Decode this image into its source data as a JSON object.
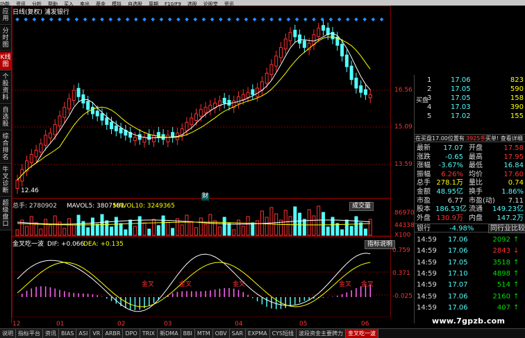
{
  "menu": [
    "功能",
    "资讯",
    "分析",
    "帮助",
    "买入",
    "卖出",
    "基金",
    "模拟",
    "自选股",
    "周期",
    "F10/F9",
    "选股",
    "论股堂",
    "资讯"
  ],
  "sidebar": [
    "应用",
    "分时图",
    "K线图",
    "个股资料",
    "自选股",
    "综合排名",
    "牛叉诊断",
    "超级盘口"
  ],
  "chart": {
    "title": "日线(复权) 浦发银行",
    "price_ticks": [
      "16.56",
      "15.09",
      "13.59"
    ],
    "low_label": "12.46",
    "cai_label": "财",
    "volume_label": "总手: 2780902",
    "mavol5": "MAVOL5: 3807581",
    "mavol10": "MAVOL10: 3249365",
    "vol_button": "成交量",
    "vol_ticks": [
      "86970",
      "44338",
      "X100"
    ],
    "macd_label": "金叉吃一波",
    "dif": "DIF: +0.066",
    "dea": "DEA: +0.135",
    "macd_button": "指标说明",
    "macd_ticks": [
      "0.759",
      "0.371",
      "-0.025"
    ],
    "jincha": "金叉",
    "months": [
      "12",
      "01",
      "02",
      "03",
      "04",
      "05",
      "06"
    ],
    "prices": [
      12.6,
      13.1,
      13.5,
      13.8,
      14.0,
      14.3,
      14.7,
      14.8,
      15.2,
      15.6,
      16.0,
      16.4,
      16.8,
      16.5,
      16.2,
      15.9,
      15.7,
      15.6,
      15.4,
      15.2,
      15.0,
      14.9,
      14.8,
      14.7,
      14.6,
      14.6,
      14.5,
      14.6,
      14.5,
      14.7,
      14.6,
      14.5,
      14.7,
      14.6,
      14.8,
      15.0,
      15.3,
      15.5,
      15.7,
      15.9,
      16.0,
      16.1,
      16.2,
      16.3,
      16.2,
      16.1,
      16.3,
      16.5,
      16.6,
      16.7,
      16.6,
      16.9,
      17.2,
      17.6,
      18.0,
      18.4,
      18.8,
      19.2,
      19.5,
      19.3,
      19.0,
      18.8,
      19.0,
      19.4,
      19.7,
      19.6,
      19.4,
      19.2,
      18.9,
      18.4,
      17.9,
      17.3,
      16.9,
      16.7,
      16.6,
      16.6
    ],
    "price_range": [
      12.0,
      20.5
    ]
  },
  "quote": {
    "sells": [
      [
        "1",
        "17.06",
        "823"
      ],
      [
        "2",
        "17.05",
        "590"
      ],
      [
        "3",
        "17.05",
        "158"
      ],
      [
        "4",
        "17.03",
        "390"
      ],
      [
        "5",
        "17.02",
        "155"
      ]
    ],
    "sell_label": "买盘",
    "info_line": "在买盘17.00位置有",
    "info_qty": "3925手",
    "info_link": "买单! 查看详细",
    "stats": [
      [
        "最新",
        "17.07",
        "开盘",
        "17.58"
      ],
      [
        "涨跌",
        "-0.65",
        "最高",
        "17.95"
      ],
      [
        "涨幅",
        "-3.67%",
        "最低",
        "16.84"
      ],
      [
        "振幅",
        "6.26%",
        "均价",
        "17.60"
      ],
      [
        "总手",
        "278.1万",
        "量比",
        "0.74"
      ],
      [
        "金额",
        "48.95亿",
        "换手",
        "1.86%"
      ],
      [
        "市盈",
        "6.77",
        "市盈(动)",
        "7.11"
      ],
      [
        "股本",
        "186.53亿",
        "流通",
        "149.23亿"
      ],
      [
        "外盘",
        "130.9万",
        "内盘",
        "147.2万"
      ]
    ],
    "sector": "银行",
    "sector_pct": "-4.98%",
    "sector_link": "同行业比较",
    "trades": [
      [
        "14:59",
        "17.06",
        "2092",
        "up"
      ],
      [
        "14:59",
        "17.06",
        "2843",
        "dn"
      ],
      [
        "14:59",
        "17.05",
        "3518",
        "up"
      ],
      [
        "14:59",
        "17.10",
        "4898",
        "up"
      ],
      [
        "14:59",
        "17.07",
        "514",
        "up"
      ],
      [
        "14:59",
        "17.06",
        "2160",
        "up"
      ],
      [
        "14:59",
        "17.06",
        "407",
        "up"
      ]
    ]
  },
  "tabs": [
    "说明",
    "指标平台",
    "资讯",
    "BIAS",
    "ASI",
    "VR",
    "ARBR",
    "DPO",
    "TRIX",
    "新DMA",
    "BBI",
    "MTM",
    "OBV",
    "SAR",
    "EXPMA",
    "CYS短线",
    "波段资金主要牌力",
    "金叉吃一波"
  ],
  "watermark": "www.7gpzb.com",
  "colors": {
    "up": "#ff3232",
    "down": "#54fcfc",
    "yellow": "#ffff00",
    "grid": "#800000"
  }
}
